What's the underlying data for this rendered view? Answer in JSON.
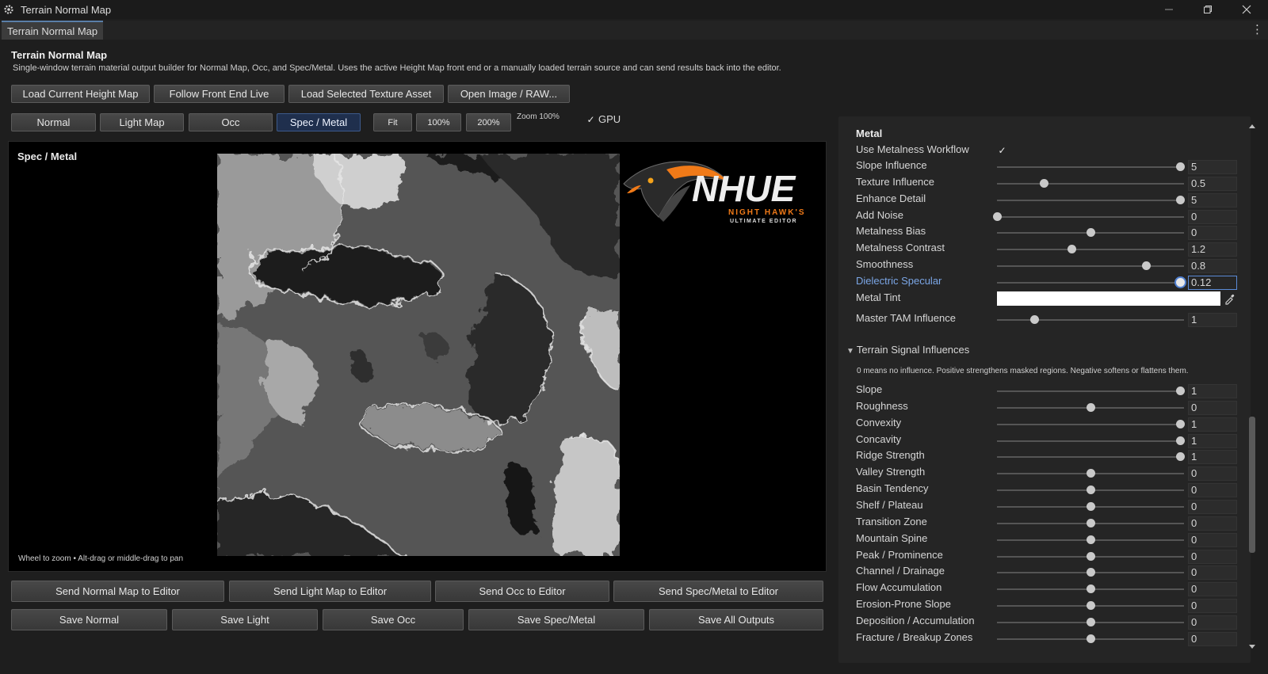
{
  "window": {
    "title": "Terrain Normal Map",
    "icon": "gear-icon",
    "controls": [
      "minimize-icon",
      "restore-icon",
      "close-icon"
    ]
  },
  "tab": {
    "label": "Terrain Normal Map",
    "menu_icon": "kebab-menu-icon"
  },
  "header": {
    "title": "Terrain Normal Map",
    "description": "Single-window terrain material output builder for Normal Map, Occ, and Spec/Metal. Uses the active Height Map front end or a manually loaded terrain source and can send results back into the editor."
  },
  "source_buttons": [
    "Load Current Height Map",
    "Follow Front End Live",
    "Load Selected Texture Asset",
    "Open Image / RAW..."
  ],
  "view_tabs": {
    "items": [
      "Normal",
      "Light Map",
      "Occ",
      "Spec / Metal"
    ],
    "selected": "Spec / Metal"
  },
  "zoom": {
    "buttons": [
      "Fit",
      "100%",
      "200%"
    ],
    "label": "Zoom 100%"
  },
  "gpu": {
    "label": "GPU",
    "checked": true
  },
  "viewport": {
    "title": "Spec / Metal",
    "hint": "Wheel to zoom • Alt-drag or middle-drag to pan",
    "logo": {
      "text": "NHUE",
      "subtitle": "NIGHT HAWK'S",
      "tagline": "ULTIMATE EDITOR"
    }
  },
  "send_buttons": [
    "Send Normal Map to Editor",
    "Send Light Map to Editor",
    "Send Occ to Editor",
    "Send Spec/Metal to Editor"
  ],
  "save_buttons": [
    "Save Normal",
    "Save Light",
    "Save Occ",
    "Save Spec/Metal",
    "Save All Outputs"
  ],
  "metal": {
    "title": "Metal",
    "workflow": {
      "label": "Use Metalness Workflow",
      "checked": true
    },
    "sliders": [
      {
        "label": "Slope Influence",
        "value": "5",
        "fraction": 0.98
      },
      {
        "label": "Texture Influence",
        "value": "0.5",
        "fraction": 0.25
      },
      {
        "label": "Enhance Detail",
        "value": "5",
        "fraction": 0.98
      },
      {
        "label": "Add Noise",
        "value": "0",
        "fraction": 0.0
      },
      {
        "label": "Metalness Bias",
        "value": "0",
        "fraction": 0.5
      },
      {
        "label": "Metalness Contrast",
        "value": "1.2",
        "fraction": 0.4
      },
      {
        "label": "Smoothness",
        "value": "0.8",
        "fraction": 0.8
      },
      {
        "label": "Dielectric Specular",
        "value": "0.12",
        "fraction": 0.98,
        "focused": true
      }
    ],
    "tint": {
      "label": "Metal Tint",
      "color": "#ffffff",
      "picker_icon": "eyedropper-icon"
    },
    "master": {
      "label": "Master TAM Influence",
      "value": "1",
      "fraction": 0.2
    }
  },
  "signals": {
    "header": "Terrain Signal Influences",
    "note": "0 means no influence. Positive strengthens masked regions. Negative softens or flattens them.",
    "sliders": [
      {
        "label": "Slope",
        "value": "1",
        "fraction": 0.98
      },
      {
        "label": "Roughness",
        "value": "0",
        "fraction": 0.5
      },
      {
        "label": "Convexity",
        "value": "1",
        "fraction": 0.98
      },
      {
        "label": "Concavity",
        "value": "1",
        "fraction": 0.98
      },
      {
        "label": "Ridge Strength",
        "value": "1",
        "fraction": 0.98
      },
      {
        "label": "Valley Strength",
        "value": "0",
        "fraction": 0.5
      },
      {
        "label": "Basin Tendency",
        "value": "0",
        "fraction": 0.5
      },
      {
        "label": "Shelf / Plateau",
        "value": "0",
        "fraction": 0.5
      },
      {
        "label": "Transition Zone",
        "value": "0",
        "fraction": 0.5
      },
      {
        "label": "Mountain Spine",
        "value": "0",
        "fraction": 0.5
      },
      {
        "label": "Peak / Prominence",
        "value": "0",
        "fraction": 0.5
      },
      {
        "label": "Channel / Drainage",
        "value": "0",
        "fraction": 0.5
      },
      {
        "label": "Flow Accumulation",
        "value": "0",
        "fraction": 0.5
      },
      {
        "label": "Erosion-Prone Slope",
        "value": "0",
        "fraction": 0.5
      },
      {
        "label": "Deposition / Accumulation",
        "value": "0",
        "fraction": 0.5
      },
      {
        "label": "Fracture / Breakup Zones",
        "value": "0",
        "fraction": 0.5
      }
    ]
  },
  "colors": {
    "accent": "#4f7fd0",
    "active_tab": "#1f2f4d",
    "background": "#1e1e1e"
  }
}
